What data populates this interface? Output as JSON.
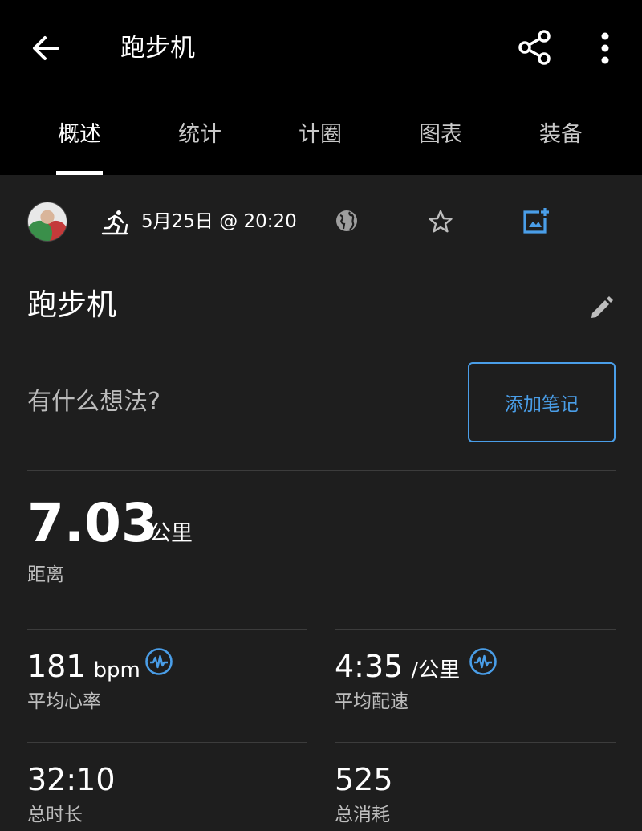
{
  "header": {
    "title": "跑步机",
    "icons": [
      "back-arrow-icon",
      "share-icon",
      "more-vert-icon"
    ]
  },
  "tabs": [
    {
      "label": "概述",
      "active": true
    },
    {
      "label": "统计"
    },
    {
      "label": "计圈"
    },
    {
      "label": "图表"
    },
    {
      "label": "装备"
    }
  ],
  "meta": {
    "date": "5月25日 @ 20:20",
    "icons": [
      "avatar",
      "treadmill-run-icon",
      "globe-icon",
      "star-icon",
      "add-photo-icon"
    ]
  },
  "activity": {
    "title": "跑步机",
    "thoughts_placeholder": "有什么想法?",
    "add_note_label": "添加笔记"
  },
  "distance": {
    "value": "7.03",
    "unit": "公里",
    "label": "距离"
  },
  "stats": [
    {
      "value": "181",
      "unit": "bpm",
      "label": "平均心率",
      "icon": "heart-rate-wave-icon"
    },
    {
      "value": "4:35",
      "unit": "/公里",
      "label": "平均配速",
      "icon": "heart-rate-wave-icon"
    },
    {
      "value": "32:10",
      "unit": "",
      "label": "总时长"
    },
    {
      "value": "525",
      "unit": "",
      "label": "总消耗"
    }
  ],
  "colors": {
    "background": "#1e1e1e",
    "header": "#000000",
    "accent": "#4a9ee8",
    "secondary_text": "#bdbdbd"
  }
}
